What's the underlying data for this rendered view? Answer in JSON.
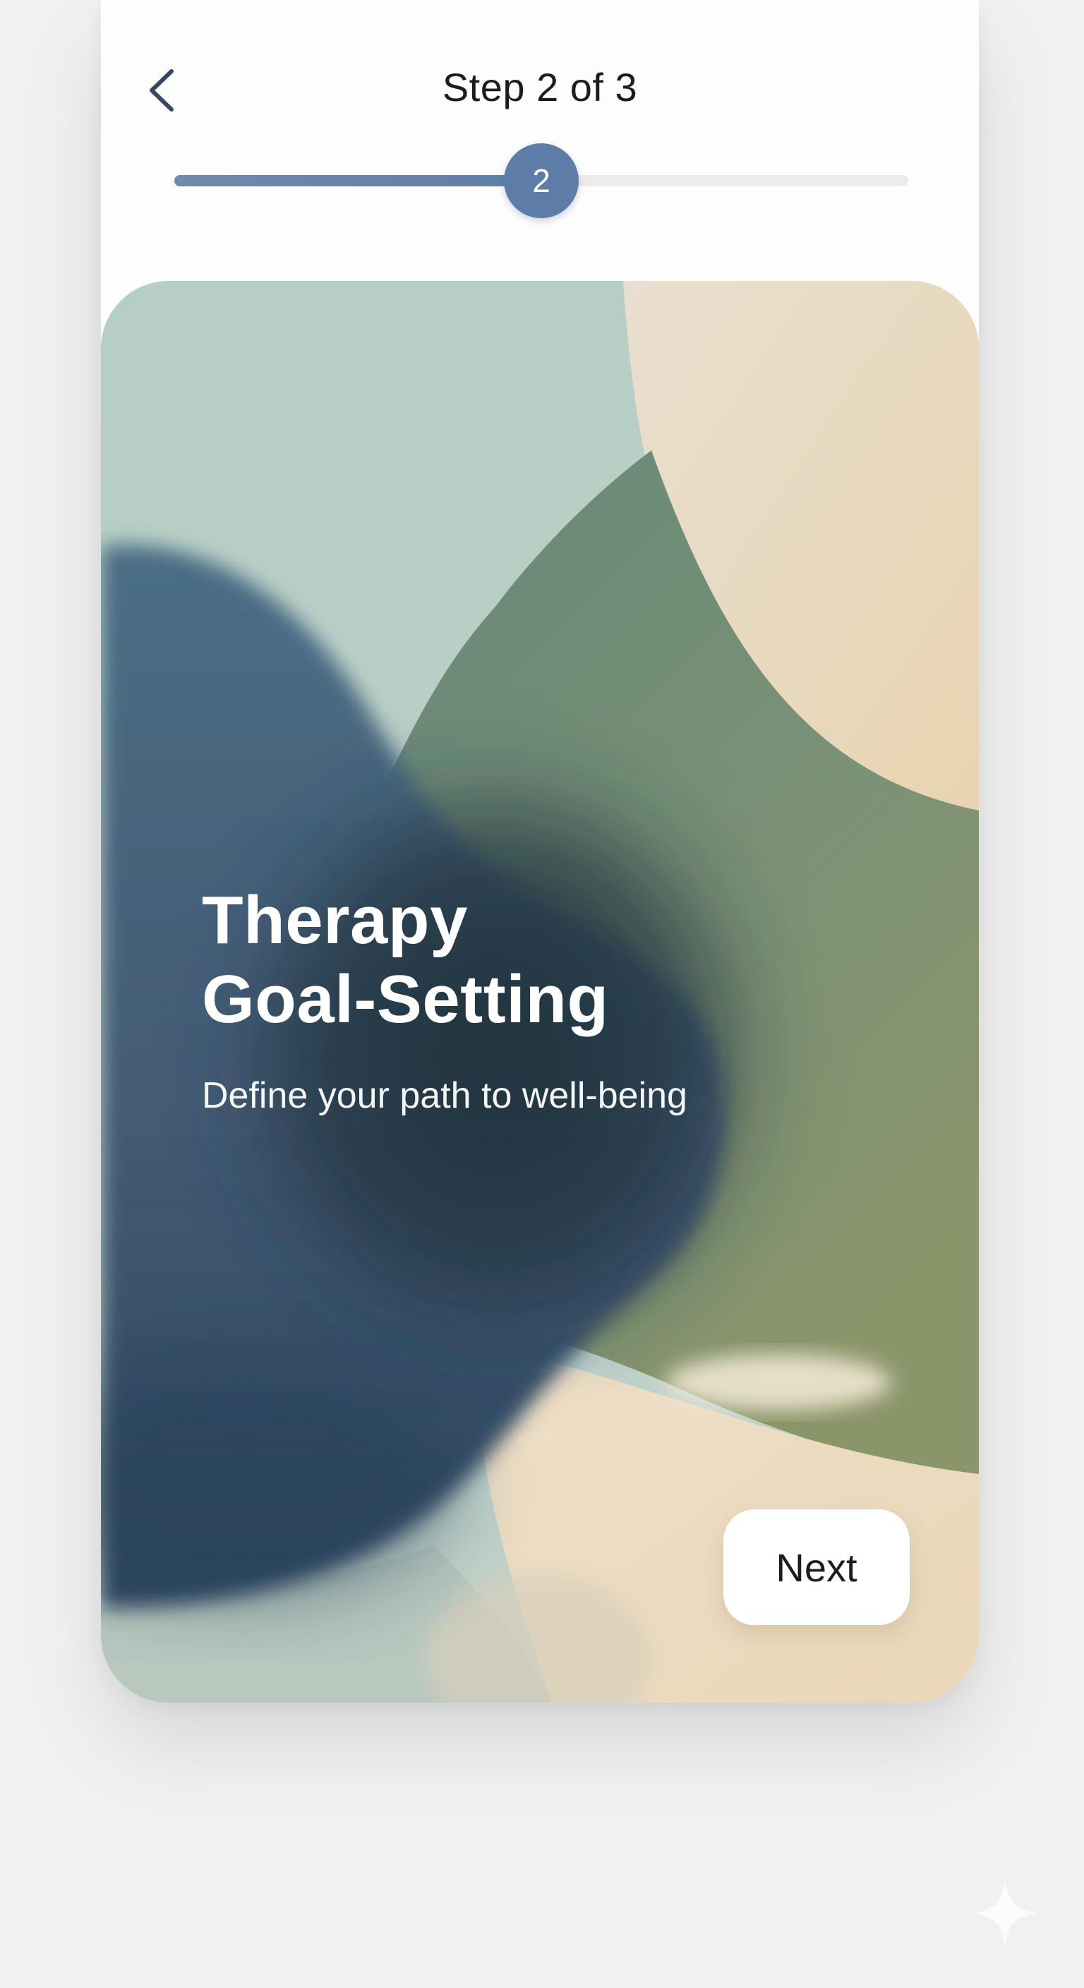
{
  "header": {
    "back_icon": "chevron-left-icon",
    "step_title": "Step 2 of 3",
    "progress": {
      "current_step": 2,
      "total_steps": 3,
      "fill_fraction": 0.5,
      "knob_label": "2"
    }
  },
  "hero": {
    "title_line1": "Therapy",
    "title_line2": "Goal-Setting",
    "subtitle": "Define your path to well-being"
  },
  "actions": {
    "next_label": "Next"
  },
  "colors": {
    "accent": "#5e7ca8",
    "sage": "#bcd0c8",
    "forest": "#6a8a78",
    "navy": "#3b5670",
    "sand": "#ead9bf"
  },
  "decor": {
    "sparkle_icon": "sparkle-icon"
  }
}
